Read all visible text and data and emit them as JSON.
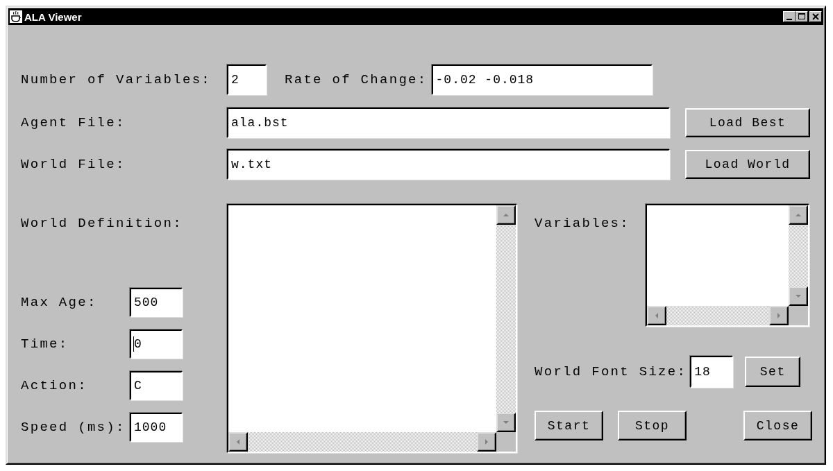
{
  "window": {
    "title": "ALA Viewer"
  },
  "number_of_variables": {
    "label": "Number of Variables:",
    "value": "2"
  },
  "rate_of_change": {
    "label": "Rate of Change:",
    "value": "-0.02 -0.018"
  },
  "files": [
    {
      "label": "Agent File:",
      "value": "ala.bst",
      "button": "Load Best"
    },
    {
      "label": "World File:",
      "value": "w.txt",
      "button": "Load World"
    }
  ],
  "world_definition": {
    "label": "World Definition:"
  },
  "params": [
    {
      "label": "Max Age:",
      "value": "500",
      "focused": false
    },
    {
      "label": "Time:",
      "value": "0",
      "focused": true
    },
    {
      "label": "Action:",
      "value": "C",
      "focused": false
    },
    {
      "label": "Speed (ms):",
      "value": "1000",
      "focused": false
    }
  ],
  "variables": {
    "label": "Variables:"
  },
  "font_size": {
    "label": "World Font Size:",
    "value": "18",
    "button": "Set"
  },
  "buttons": [
    {
      "label": "Start",
      "kind": "left"
    },
    {
      "label": "Stop",
      "kind": "left"
    },
    {
      "label": "Close",
      "kind": "right"
    }
  ]
}
